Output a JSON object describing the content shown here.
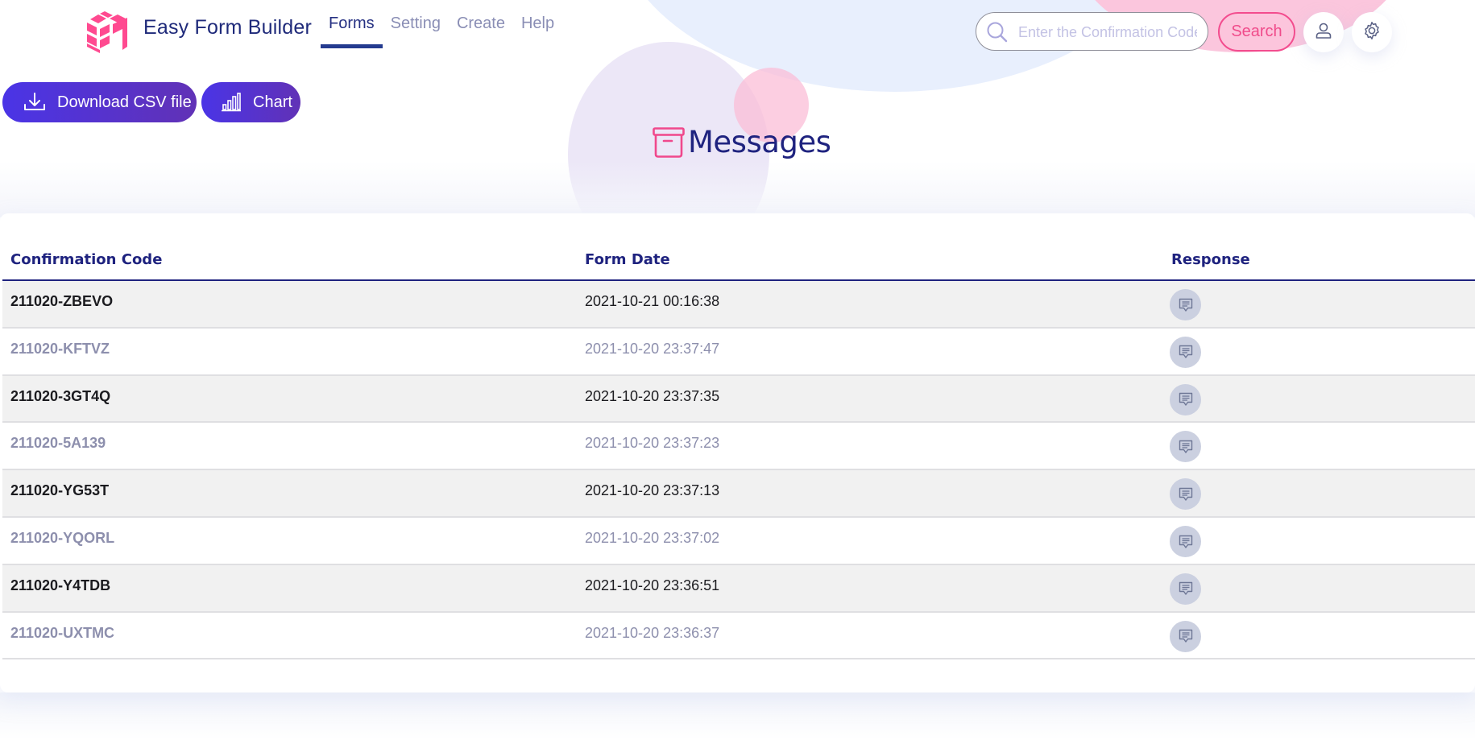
{
  "header": {
    "brand": "Easy Form Builder",
    "nav": [
      {
        "label": "Forms",
        "active": true
      },
      {
        "label": "Setting",
        "active": false
      },
      {
        "label": "Create",
        "active": false
      },
      {
        "label": "Help",
        "active": false
      }
    ],
    "search": {
      "placeholder": "Enter the Confirmation Code",
      "value": "",
      "button_label": "Search",
      "icon": "search-icon"
    },
    "user_icon": "user-icon",
    "settings_icon": "gear-icon"
  },
  "actions": {
    "download_csv_label": "Download CSV file",
    "download_icon": "download-icon",
    "chart_label": "Chart",
    "chart_icon": "bar-chart-icon"
  },
  "page": {
    "title": "Messages",
    "title_icon": "archive-box-icon"
  },
  "table": {
    "columns": [
      "Confirmation Code",
      "Form Date",
      "Response"
    ],
    "rows": [
      {
        "code": "211020-ZBEVO",
        "date": "2021-10-21 00:16:38",
        "response_icon": "message-icon"
      },
      {
        "code": "211020-KFTVZ",
        "date": "2021-10-20 23:37:47",
        "response_icon": "message-icon"
      },
      {
        "code": "211020-3GT4Q",
        "date": "2021-10-20 23:37:35",
        "response_icon": "message-icon"
      },
      {
        "code": "211020-5A139",
        "date": "2021-10-20 23:37:23",
        "response_icon": "message-icon"
      },
      {
        "code": "211020-YG53T",
        "date": "2021-10-20 23:37:13",
        "response_icon": "message-icon"
      },
      {
        "code": "211020-YQORL",
        "date": "2021-10-20 23:37:02",
        "response_icon": "message-icon"
      },
      {
        "code": "211020-Y4TDB",
        "date": "2021-10-20 23:36:51",
        "response_icon": "message-icon"
      },
      {
        "code": "211020-UXTMC",
        "date": "2021-10-20 23:36:37",
        "response_icon": "message-icon"
      }
    ]
  },
  "colors": {
    "brand_navy": "#1f237f",
    "accent_pink": "#f34c8e",
    "button_gradient_start": "#4a34e6",
    "button_gradient_end": "#6132b6",
    "row_alt": "#f1f1f1",
    "muted_text": "#8d8fad"
  }
}
